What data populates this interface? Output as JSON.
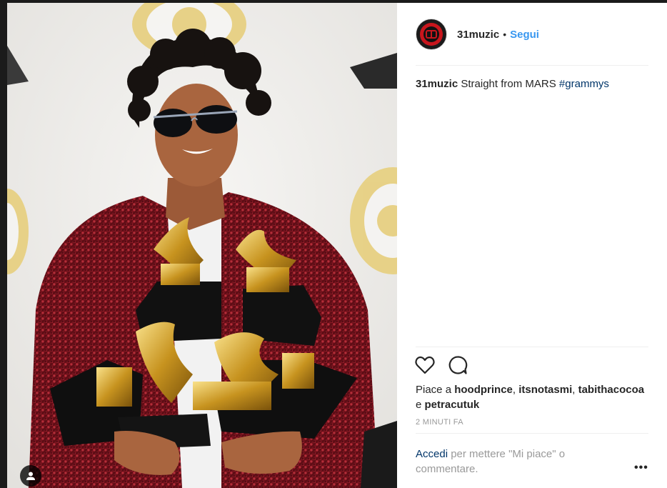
{
  "post": {
    "username": "31muzic",
    "follow_label": "Segui",
    "caption_user": "31muzic",
    "caption_text": "Straight from MARS",
    "caption_hashtag": "#grammys",
    "likes_prefix": "Piace a",
    "likes_users": [
      "hoodprince",
      "itsnotasmi",
      "tabithacocoa",
      "petracutuk"
    ],
    "likes_separator": ",",
    "likes_conjunction": "e",
    "timestamp": "2 MINUTI FA",
    "login_link": "Accedi",
    "login_text": "per mettere \"Mi piace\" o commentare.",
    "more_label": "•••"
  },
  "icons": {
    "like": "heart-icon",
    "comment": "comment-bubble-icon",
    "tag": "user-tag-icon",
    "avatar": "channel-logo"
  },
  "colors": {
    "link_blue": "#3897f0",
    "hashtag_navy": "#003569",
    "text": "#262626",
    "muted": "#999999"
  }
}
